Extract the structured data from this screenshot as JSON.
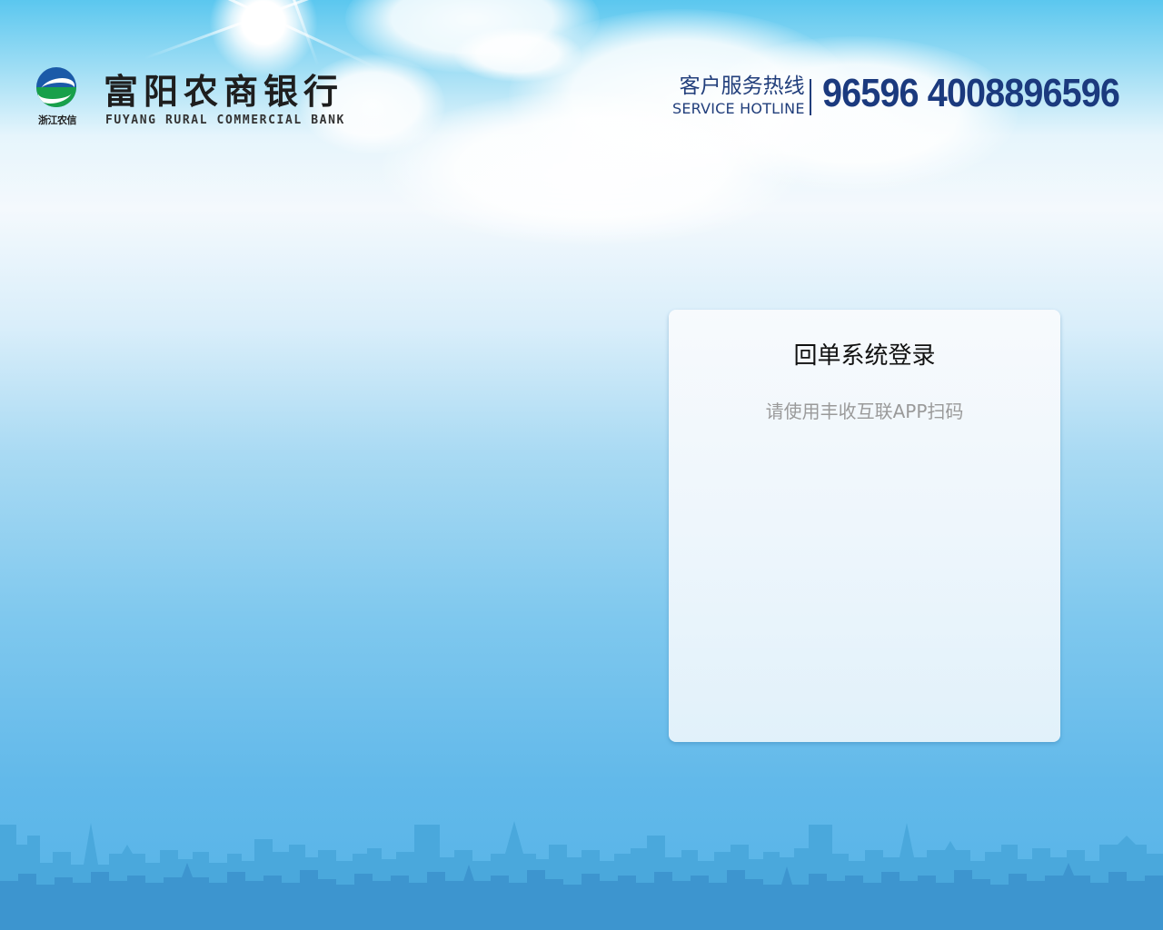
{
  "header": {
    "logo_sub_text": "浙江农信",
    "bank_name": "富阳农商银行",
    "bank_name_en": "FUYANG RURAL COMMERCIAL BANK",
    "hotline_label_cn": "客户服务热线",
    "hotline_label_en": "SERVICE HOTLINE",
    "hotline_numbers": "96596 4008896596"
  },
  "login": {
    "title": "回单系统登录",
    "hint": "请使用丰收互联APP扫码"
  },
  "colors": {
    "hotline": "#1b3a7e",
    "sky_top": "#5bc7ef",
    "sky_bottom": "#55b3e7",
    "skyline_light": "#4aa8dc",
    "skyline_dark": "#3d95cf",
    "logo_blue": "#1b5aa8",
    "logo_green": "#18a04a"
  }
}
